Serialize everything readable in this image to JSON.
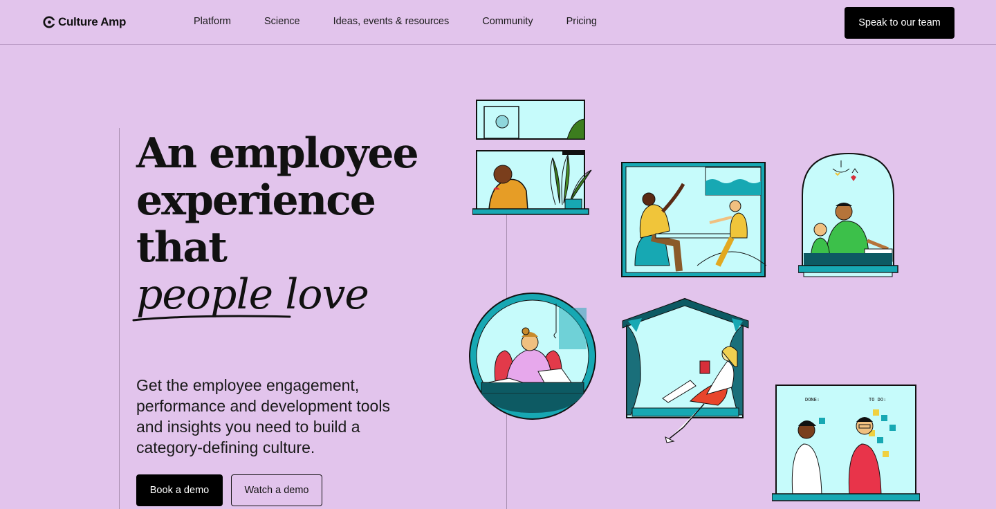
{
  "brand": {
    "name": "Culture Amp",
    "logo_icon": "culture-amp-logo-icon"
  },
  "nav": {
    "items": [
      {
        "label": "Platform"
      },
      {
        "label": "Science"
      },
      {
        "label": "Ideas, events & resources"
      },
      {
        "label": "Community"
      },
      {
        "label": "Pricing"
      }
    ],
    "cta_label": "Speak to our team"
  },
  "hero": {
    "headline_line1": "An employee",
    "headline_line2": "experience",
    "headline_line3_prefix": "that",
    "headline_script": "people love",
    "subtext": "Get the employee engagement, performance and development tools and insights you need to build a category-defining culture.",
    "primary_button": "Book a demo",
    "secondary_button": "Watch a demo"
  },
  "illustrations": {
    "whiteboard_done": "DONE:",
    "whiteboard_todo": "TO DO:"
  },
  "colors": {
    "background": "#e2c4ec",
    "teal": "#17a8b3",
    "light_teal": "#c6fbfb",
    "black": "#000000"
  }
}
